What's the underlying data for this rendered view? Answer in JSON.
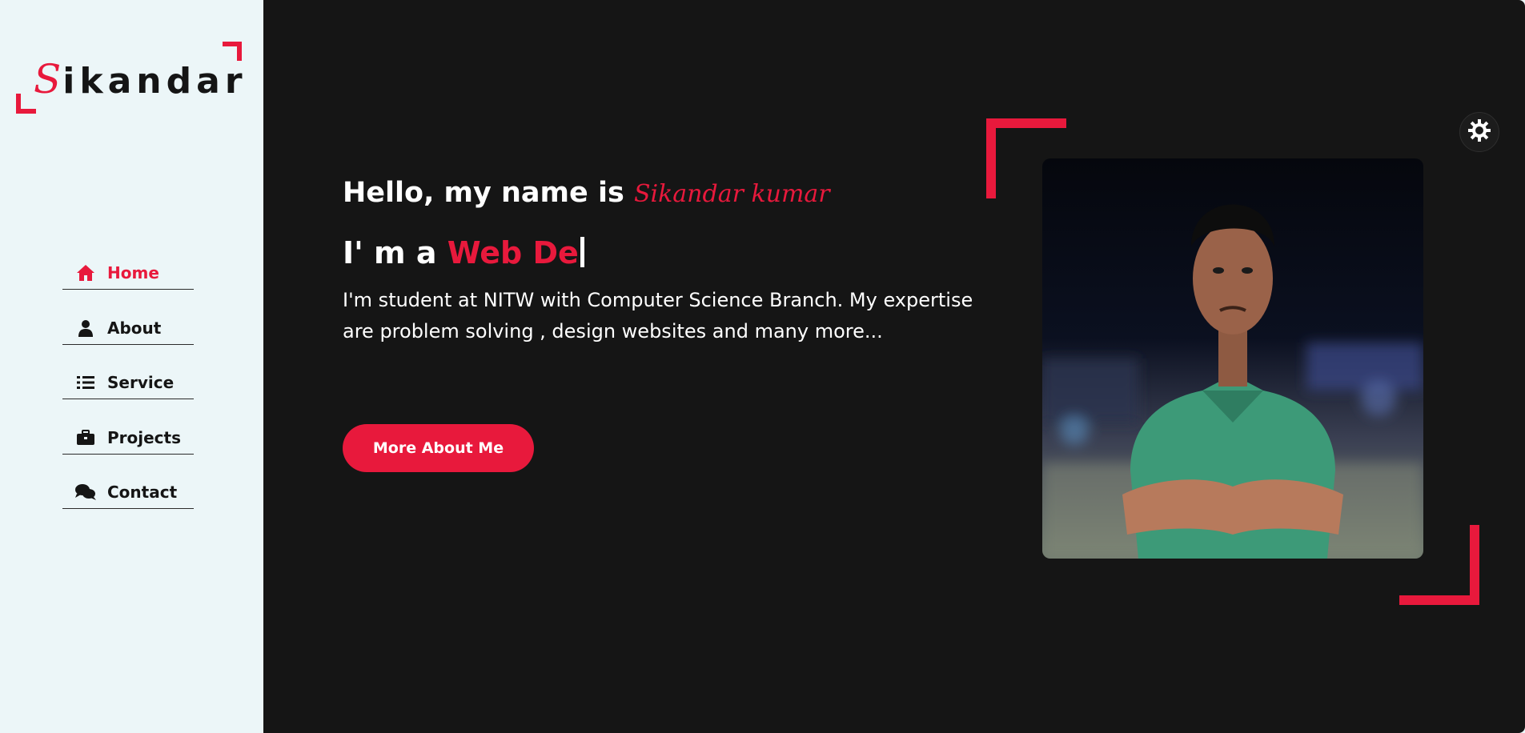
{
  "brand": {
    "logo_initial": "S",
    "logo_rest": "ikandar",
    "accent_color": "#e8193c",
    "sidebar_bg": "#ecf6f8",
    "main_bg": "#151515"
  },
  "nav": {
    "items": [
      {
        "label": "Home",
        "icon": "home-icon",
        "active": true
      },
      {
        "label": "About",
        "icon": "user-icon",
        "active": false
      },
      {
        "label": "Service",
        "icon": "list-icon",
        "active": false
      },
      {
        "label": "Projects",
        "icon": "briefcase-icon",
        "active": false
      },
      {
        "label": "Contact",
        "icon": "chat-icon",
        "active": false
      }
    ]
  },
  "hero": {
    "greeting_prefix": "Hello, my name is ",
    "name": "Sikandar kumar",
    "role_prefix": "I' m a ",
    "role_typed": "Web De",
    "bio": "I'm student at NITW with Computer Science Branch. My expertise are problem solving , design websites and many more...",
    "cta_label": "More About Me"
  },
  "theme_toggle": {
    "icon": "sun-gear-icon"
  }
}
